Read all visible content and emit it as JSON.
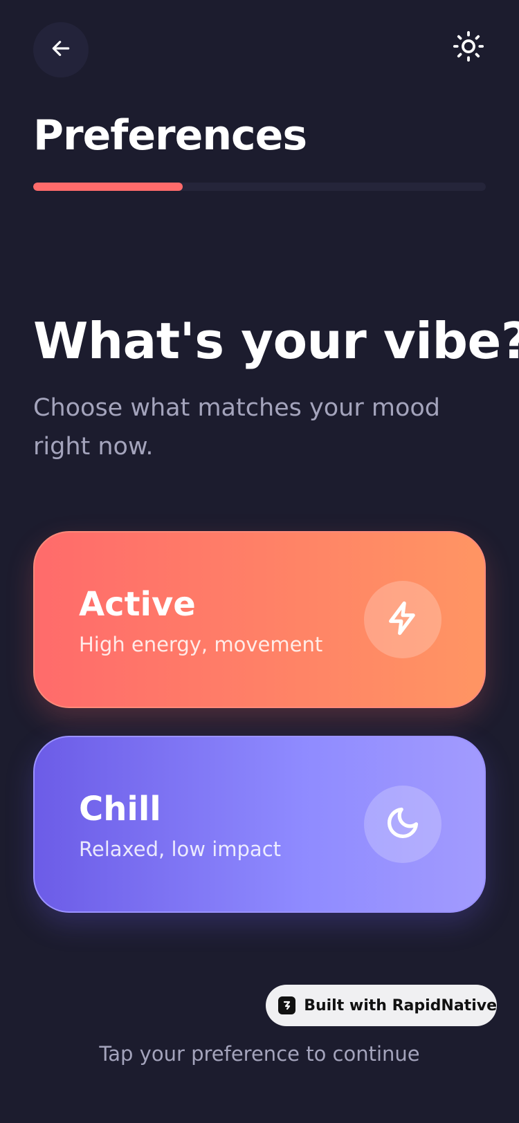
{
  "header": {
    "back_icon": "arrow-left-icon",
    "theme_icon": "sun-icon"
  },
  "page": {
    "title": "Preferences",
    "progress_fraction": 0.33
  },
  "question": {
    "heading": "What's your vibe?",
    "subtitle": "Choose what matches your mood right now."
  },
  "options": [
    {
      "title": "Active",
      "description": "High energy, movement",
      "icon": "lightning-bolt-icon",
      "gradient": [
        "#ff6b6b",
        "#ff9563"
      ]
    },
    {
      "title": "Chill",
      "description": "Relaxed, low impact",
      "icon": "moon-icon",
      "gradient": [
        "#6c5ce7",
        "#a29bfe"
      ]
    }
  ],
  "badge": {
    "label": "Built with RapidNative",
    "icon": "rapidnative-logo-icon"
  },
  "footer": {
    "hint": "Tap your preference to continue"
  },
  "colors": {
    "background": "#1c1c2e",
    "accent": "#ff6b6b",
    "muted_text": "#a4a4bc"
  }
}
